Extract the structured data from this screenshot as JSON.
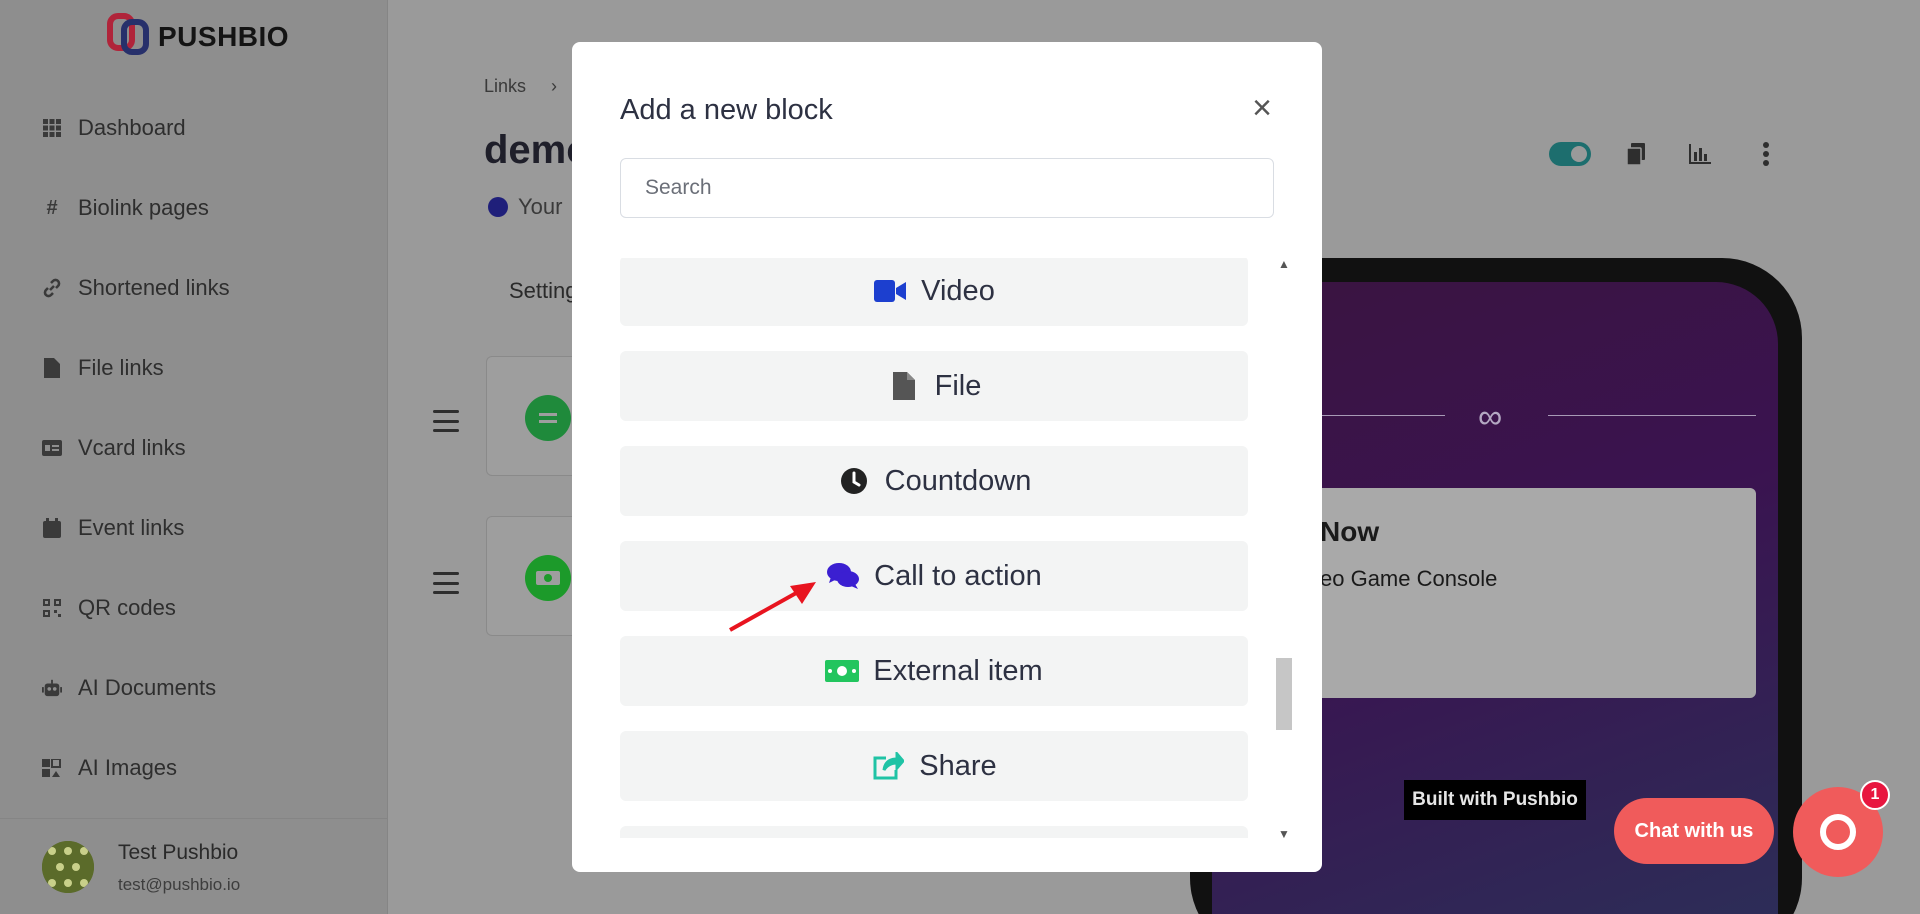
{
  "brand": {
    "name": "PUSHBIO"
  },
  "sidebar": {
    "items": [
      {
        "label": "Dashboard",
        "icon": "grid-icon"
      },
      {
        "label": "Biolink pages",
        "icon": "hash-icon"
      },
      {
        "label": "Shortened links",
        "icon": "link-icon"
      },
      {
        "label": "File links",
        "icon": "file-icon"
      },
      {
        "label": "Vcard links",
        "icon": "id-card-icon"
      },
      {
        "label": "Event links",
        "icon": "calendar-icon"
      },
      {
        "label": "QR codes",
        "icon": "qrcode-icon"
      },
      {
        "label": "AI Documents",
        "icon": "robot-icon"
      },
      {
        "label": "AI Images",
        "icon": "images-icon"
      }
    ],
    "user": {
      "name": "Test Pushbio",
      "email": "test@pushbio.io"
    }
  },
  "main": {
    "breadcrumb": "Links",
    "breadcrumb_sep": "›",
    "title": "demo",
    "subtitle": "Your",
    "tab": "Settings",
    "colors": {
      "enabled_toggle": "#1d6e6e"
    }
  },
  "modal": {
    "title": "Add a new block",
    "close": "×",
    "search_placeholder": "Search",
    "blocks": [
      {
        "label": "Video",
        "icon": "video-icon",
        "color": "#1c3fcf"
      },
      {
        "label": "File",
        "icon": "file-icon",
        "color": "#555555"
      },
      {
        "label": "Countdown",
        "icon": "clock-icon",
        "color": "#222222"
      },
      {
        "label": "Call to action",
        "icon": "comments-icon",
        "color": "#3b1fd1"
      },
      {
        "label": "External item",
        "icon": "money-icon",
        "color": "#22c55e"
      },
      {
        "label": "Share",
        "icon": "share-icon",
        "color": "#1fc3a5"
      }
    ]
  },
  "preview": {
    "divider_icon": "∞",
    "product_title": "Now",
    "product_subtitle": "eo Game Console",
    "built_with": "Built with Pushbio"
  },
  "chat": {
    "label": "Chat with us",
    "badge": "1",
    "accent": "#f05b5b"
  }
}
